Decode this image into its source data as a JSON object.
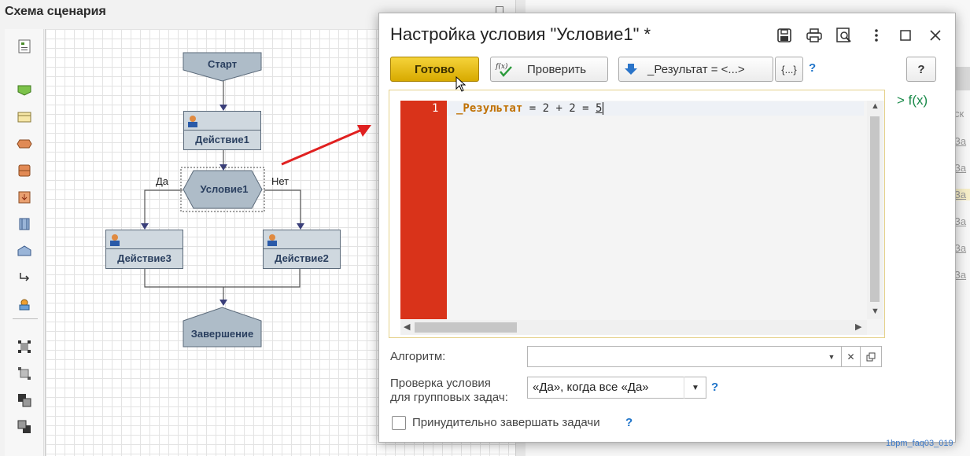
{
  "scheme": {
    "title": "Схема сценария",
    "nodes": {
      "start": "Старт",
      "action1": "Действие1",
      "condition1": "Условие1",
      "action3": "Действие3",
      "action2": "Действие2",
      "end": "Завершение"
    },
    "branch_yes": "Да",
    "branch_no": "Нет",
    "palette_icons": [
      "scheme-icon",
      "action-shape-icon",
      "form-shape-icon",
      "condition-shape-icon",
      "database-shape-icon",
      "subprocess-shape-icon",
      "split-shape-icon",
      "merge-shape-icon",
      "connector-icon",
      "settings-shape-icon",
      "select-all-icon",
      "select-icon",
      "bring-front-icon",
      "send-back-icon"
    ]
  },
  "background": {
    "column_header_fragment": "ск",
    "row_links": [
      "За",
      "За",
      "За",
      "За",
      "За",
      "За"
    ]
  },
  "dialog": {
    "title": "Настройка условия \"Условие1\" *",
    "toolbar_icons": [
      "save-icon",
      "print-icon",
      "preview-icon",
      "more-icon",
      "maximize-icon",
      "close-icon"
    ],
    "buttons": {
      "done": "Готово",
      "check": "Проверить",
      "check_icon": "fx-check-icon",
      "result": "_Результат = <...>",
      "result_icon": "down-arrow-icon",
      "braces": "{...}",
      "help": "?"
    },
    "editor": {
      "line_number": "1",
      "code_keyword": "_Результат",
      "code_rest": " = 2 + 2 = ",
      "code_last": "5"
    },
    "fx_link": "f(x)",
    "algorithm": {
      "label": "Алгоритм:",
      "value": ""
    },
    "group_check": {
      "label_line1": "Проверка условия",
      "label_line2": "для групповых задач:",
      "selected": "«Да», когда все «Да»"
    },
    "force_finish": {
      "label": "Принудительно завершать задачи",
      "checked": false
    },
    "help_mark": "?"
  },
  "watermark": "1bpm_faq03_019",
  "colors": {
    "accent_yellow": "#E6BE12",
    "gutter_red": "#D9331A",
    "node_fill": "#CFD8DF",
    "link_blue": "#1D73C9",
    "fx_green": "#1A8A4A"
  }
}
